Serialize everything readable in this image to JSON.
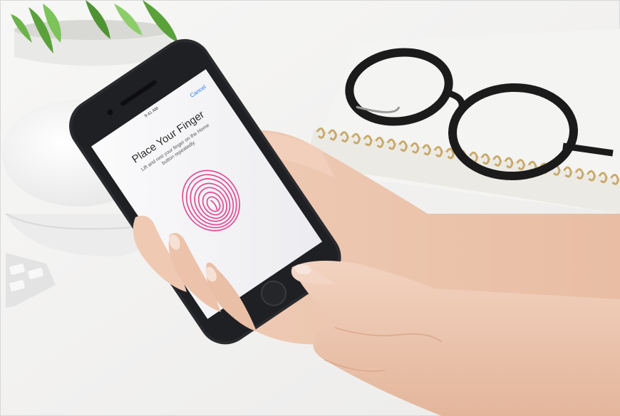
{
  "phone": {
    "status_time": "9:41 AM",
    "cancel_label": "Cancel",
    "title": "Place Your Finger",
    "instruction_line1": "Lift and rest your finger on the Home",
    "instruction_line2": "button repeatedly."
  },
  "colors": {
    "desk": "#f3f3f2",
    "phone_body": "#2a2b2e",
    "screen": "#f6f6f8",
    "fingerprint": "#e0529a",
    "cancel": "#2f7cf6",
    "skin": "#edc6ae",
    "plant_leaf": "#5aa13a"
  },
  "icons": [
    "fingerprint-icon"
  ]
}
